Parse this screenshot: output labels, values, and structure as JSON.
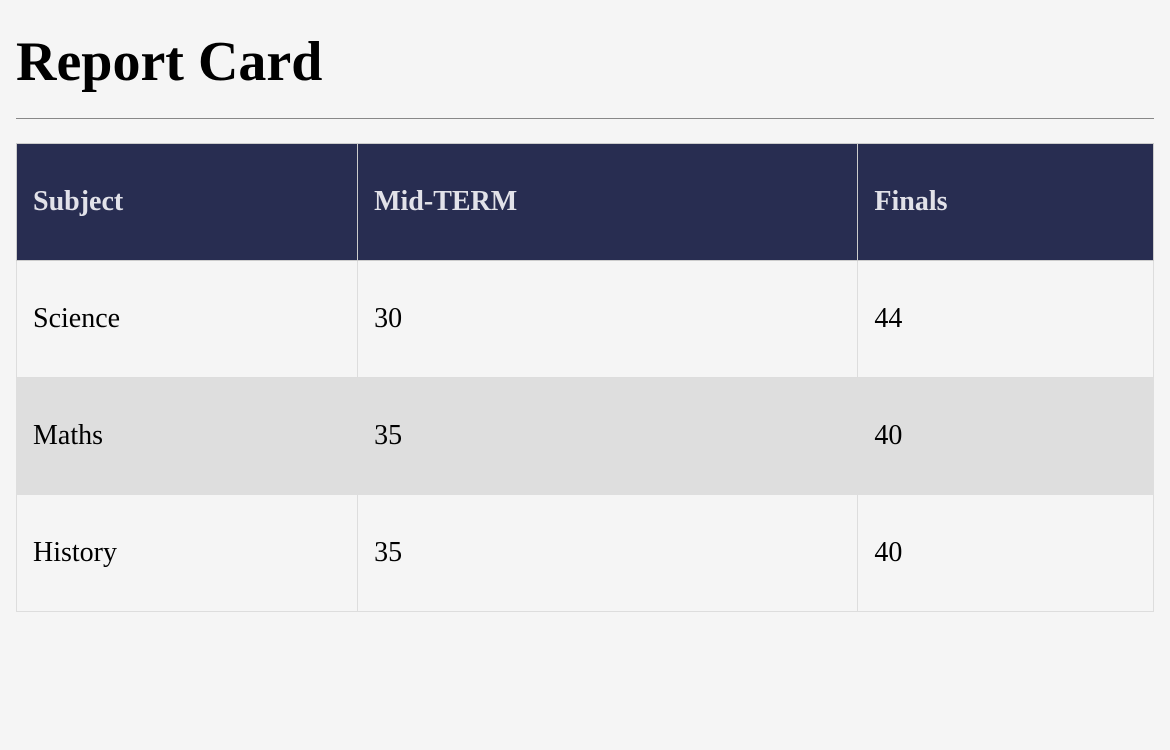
{
  "title": "Report Card",
  "table": {
    "headers": {
      "subject": "Subject",
      "midterm": "Mid-TERM",
      "finals": "Finals"
    },
    "rows": [
      {
        "subject": "Science",
        "midterm": "30",
        "finals": "44"
      },
      {
        "subject": "Maths",
        "midterm": "35",
        "finals": "40"
      },
      {
        "subject": "History",
        "midterm": "35",
        "finals": "40"
      }
    ]
  }
}
